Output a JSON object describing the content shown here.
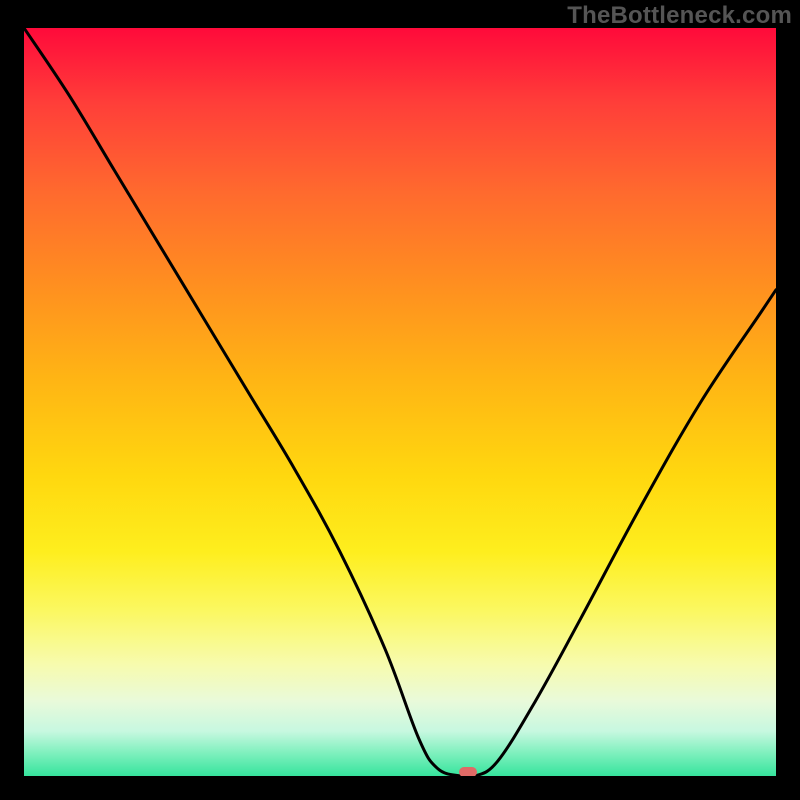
{
  "watermark": "TheBottleneck.com",
  "colors": {
    "frame": "#000000",
    "curve": "#000000",
    "marker": "#e06a66"
  },
  "chart_data": {
    "type": "line",
    "title": "",
    "xlabel": "",
    "ylabel": "",
    "xlim": [
      0,
      100
    ],
    "ylim": [
      0,
      100
    ],
    "x": [
      0,
      6,
      12,
      18,
      24,
      30,
      36,
      42,
      48,
      52.5,
      55,
      58,
      60,
      63,
      68,
      74,
      82,
      90,
      98,
      100
    ],
    "values": [
      100,
      91,
      81,
      71,
      61,
      51,
      41,
      30,
      17,
      5,
      1,
      0,
      0,
      2,
      10,
      21,
      36,
      50,
      62,
      65
    ],
    "marker": {
      "x": 59,
      "y": 0.5
    },
    "background_gradient": [
      {
        "stop": 0,
        "color": "#ff0a3a"
      },
      {
        "stop": 10,
        "color": "#ff3e39"
      },
      {
        "stop": 22,
        "color": "#ff6a2e"
      },
      {
        "stop": 34,
        "color": "#ff8e20"
      },
      {
        "stop": 47,
        "color": "#ffb514"
      },
      {
        "stop": 60,
        "color": "#ffd80f"
      },
      {
        "stop": 70,
        "color": "#feee1e"
      },
      {
        "stop": 78,
        "color": "#fbf862"
      },
      {
        "stop": 85,
        "color": "#f7fbad"
      },
      {
        "stop": 90,
        "color": "#e9fada"
      },
      {
        "stop": 94,
        "color": "#c7f8e0"
      },
      {
        "stop": 97,
        "color": "#7df0bd"
      },
      {
        "stop": 100,
        "color": "#36e49d"
      }
    ]
  }
}
